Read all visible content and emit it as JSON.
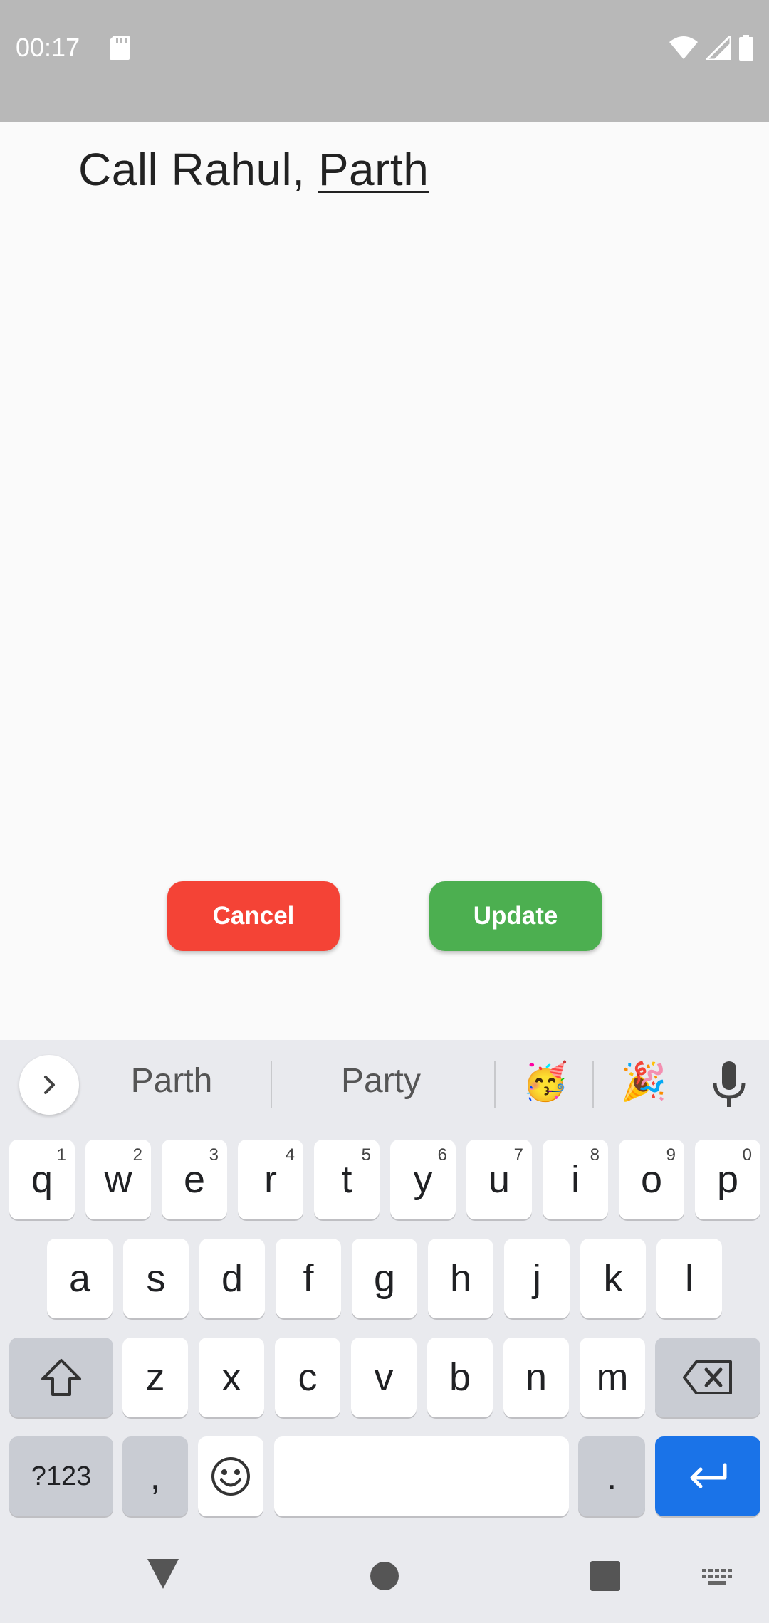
{
  "status_bar": {
    "time": "00:17",
    "icons": [
      "sd-card-icon",
      "wifi-icon",
      "signal-icon",
      "battery-icon"
    ]
  },
  "editor": {
    "text_committed": "Call Rahul, ",
    "text_composing": "Parth"
  },
  "buttons": {
    "cancel": "Cancel",
    "update": "Update"
  },
  "colors": {
    "cancel": "#f44336",
    "update": "#4caf50",
    "enter": "#1a73e8"
  },
  "keyboard": {
    "suggestions": [
      "Parth",
      "Party"
    ],
    "emoji_suggestions": [
      "🥳",
      "🎉"
    ],
    "row1": [
      {
        "k": "q",
        "h": "1"
      },
      {
        "k": "w",
        "h": "2"
      },
      {
        "k": "e",
        "h": "3"
      },
      {
        "k": "r",
        "h": "4"
      },
      {
        "k": "t",
        "h": "5"
      },
      {
        "k": "y",
        "h": "6"
      },
      {
        "k": "u",
        "h": "7"
      },
      {
        "k": "i",
        "h": "8"
      },
      {
        "k": "o",
        "h": "9"
      },
      {
        "k": "p",
        "h": "0"
      }
    ],
    "row2": [
      "a",
      "s",
      "d",
      "f",
      "g",
      "h",
      "j",
      "k",
      "l"
    ],
    "row3": [
      "z",
      "x",
      "c",
      "v",
      "b",
      "n",
      "m"
    ],
    "symbols_label": "?123",
    "comma_label": ",",
    "period_label": "."
  }
}
